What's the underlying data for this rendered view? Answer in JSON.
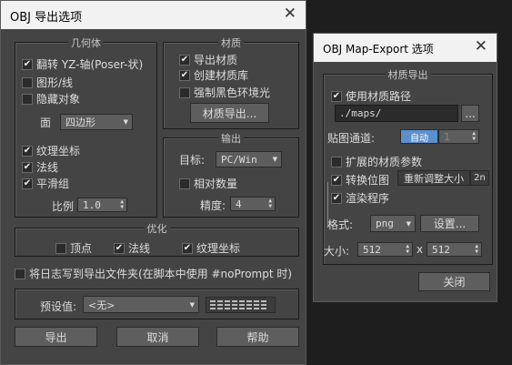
{
  "win1": {
    "title": "OBJ 导出选项",
    "geometry": {
      "header": "几何体",
      "flip": "翻转 YZ-轴(Poser-状)",
      "shapes": "图形/线",
      "hidden": "隐藏对象",
      "face_label": "面",
      "face_value": "四边形",
      "texcoords": "纹理坐标",
      "normals": "法线",
      "smooth": "平滑组",
      "scale_label": "比例",
      "scale_value": "1.0"
    },
    "material": {
      "header": "材质",
      "export_mat": "导出材质",
      "create_lib": "创建材质库",
      "force_black": "强制黑色环境光",
      "export_btn": "材质导出..."
    },
    "output": {
      "header": "输出",
      "target_label": "目标:",
      "target_value": "PC/Win",
      "relative": "相对数量",
      "precision_label": "精度:",
      "precision_value": "4"
    },
    "optimize": {
      "header": "优化",
      "vertices": "顶点",
      "normals": "法线",
      "texcoords": "纹理坐标"
    },
    "log": "将日志写到导出文件夹(在脚本中使用 #noPrompt 时)",
    "preset_label": "预设值:",
    "preset_value": "<无>",
    "export": "导出",
    "cancel": "取消",
    "help": "帮助"
  },
  "win2": {
    "title": "OBJ Map-Export 选项",
    "header": "材质导出",
    "use_path": "使用材质路径",
    "path": "./maps/",
    "browse": "...",
    "channel_label": "贴图通道:",
    "channel_auto": "自动",
    "channel_value": "1",
    "extended": "扩展的材质参数",
    "convert": "转换位图",
    "rescale": "重新调整大小",
    "pow2": "2n",
    "render": "渲染程序",
    "format_label": "格式:",
    "format_value": "png",
    "settings": "设置...",
    "size_label": "大小:",
    "width": "512",
    "x": "x",
    "height": "512",
    "close": "关闭"
  },
  "colors": {
    "accent": "#5b8fd0",
    "dialog_bg": "#444444",
    "titlebar": "#f2f2f2"
  }
}
